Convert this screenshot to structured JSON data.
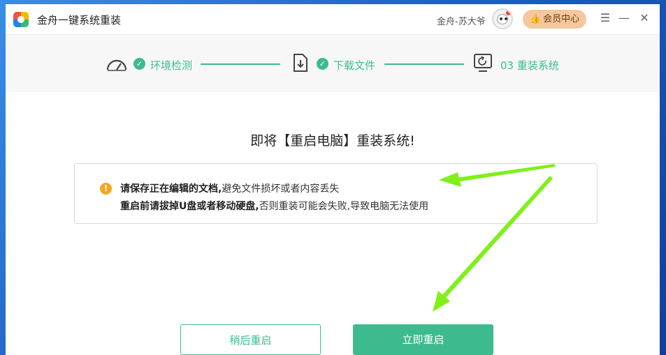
{
  "window": {
    "app_title": "金舟一键系统重装"
  },
  "header": {
    "user_name": "金舟-苏大爷",
    "vip_label": "会员中心",
    "menu_glyph": "☰",
    "minimize_glyph": "—",
    "close_glyph": "✕"
  },
  "steps": [
    {
      "label": "环境检测",
      "icon": "speedometer-icon",
      "status": "done"
    },
    {
      "label": "下载文件",
      "icon": "download-file-icon",
      "status": "done"
    },
    {
      "label": "03 重装系统",
      "icon": "monitor-restart-icon",
      "status": "current"
    }
  ],
  "main": {
    "headline": "即将【重启电脑】重装系统!",
    "notice": {
      "line1_bold": "请保存正在编辑的文档,",
      "line1_rest": "避免文件损坏或者内容丢失",
      "line2_bold": "重启前请拔掉U盘或者移动硬盘,",
      "line2_rest": "否则重装可能会失败,导致电脑无法使用"
    }
  },
  "buttons": {
    "later": "稍后重启",
    "now": "立即重启"
  },
  "colors": {
    "accent": "#3dbb8f",
    "vip_bg": "#f5c79d",
    "warning": "#f5a623",
    "annotation_arrow": "#7ff018"
  }
}
